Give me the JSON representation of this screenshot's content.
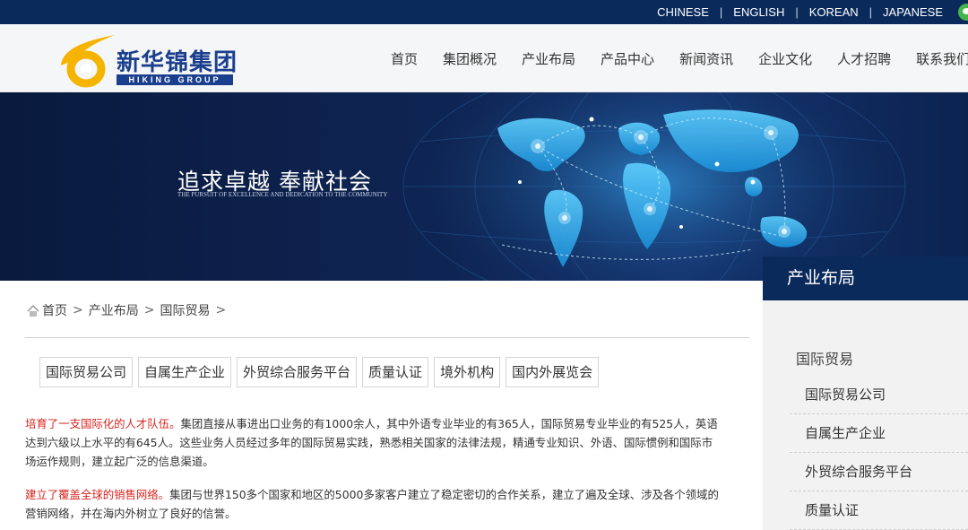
{
  "languages": [
    "CHINESE",
    "ENGLISH",
    "KOREAN",
    "JAPANESE"
  ],
  "brand": {
    "name_cn": "新华锦集团",
    "name_en": "HIKING GROUP"
  },
  "nav": [
    "首页",
    "集团概况",
    "产业布局",
    "产品中心",
    "新闻资讯",
    "企业文化",
    "人才招聘",
    "联系我们"
  ],
  "banner": {
    "slogan": "追求卓越  奉献社会",
    "slogan_sub": "THE PURSUIT OF EXCELLENCE AND DEDICATION TO THE COMMUNITY"
  },
  "breadcrumb": [
    "首页",
    "产业布局",
    "国际贸易"
  ],
  "breadcrumb_sep": ">",
  "tabs": [
    "国际贸易公司",
    "自属生产企业",
    "外贸综合服务平台",
    "质量认证",
    "境外机构",
    "国内外展览会"
  ],
  "content": {
    "p1_highlight": "培育了一支国际化的人才队伍。",
    "p1_line1": "集团直接从事进出口业务的有1000余人，其中外语专业毕业的有365人，国际贸易专业毕业的有525人，英语",
    "p1_line2": "达到六级以上水平的有645人。这些业务人员经过多年的国际贸易实践，熟悉相关国家的法律法规，精通专业知识、外语、国际惯例和国际市",
    "p1_line3": "场运作规则，建立起广泛的信息渠道。",
    "p2_highlight": "建立了覆盖全球的销售网络。",
    "p2_line1": "集团与世界150多个国家和地区的5000多家客户建立了稳定密切的合作关系，建立了遍及全球、涉及各个领域的",
    "p2_line2": "营销网络，并在海内外树立了良好的信誉。"
  },
  "sidebar": {
    "title": "产业布局",
    "subtitle": "国际贸易",
    "links": [
      "国际贸易公司",
      "自属生产企业",
      "外贸综合服务平台",
      "质量认证"
    ]
  },
  "colors": {
    "navy": "#0b2a5c",
    "highlight": "#d7261f",
    "logo_blue": "#1b3f8f",
    "logo_yellow": "#f4b400"
  },
  "icons": [
    "wechat-icon",
    "home-icon"
  ]
}
